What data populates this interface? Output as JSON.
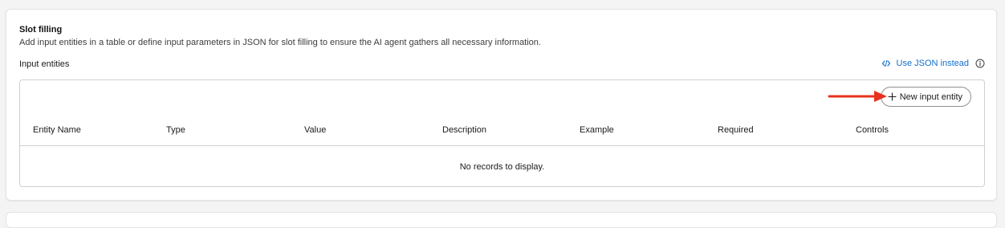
{
  "slot_filling": {
    "title": "Slot filling",
    "description": "Add input entities in a table or define input parameters in JSON for slot filling to ensure the AI agent gathers all necessary information."
  },
  "input_entities": {
    "label": "Input entities",
    "json_link_label": "Use JSON instead",
    "new_button_label": "New input entity",
    "columns": [
      "Entity Name",
      "Type",
      "Value",
      "Description",
      "Example",
      "Required",
      "Controls"
    ],
    "empty_message": "No records to display."
  },
  "colors": {
    "link": "#1170cf",
    "annotation_arrow": "#e8321e"
  },
  "icons": {
    "json_link": "code-icon",
    "info": "info-icon",
    "new_button": "plus-icon"
  }
}
